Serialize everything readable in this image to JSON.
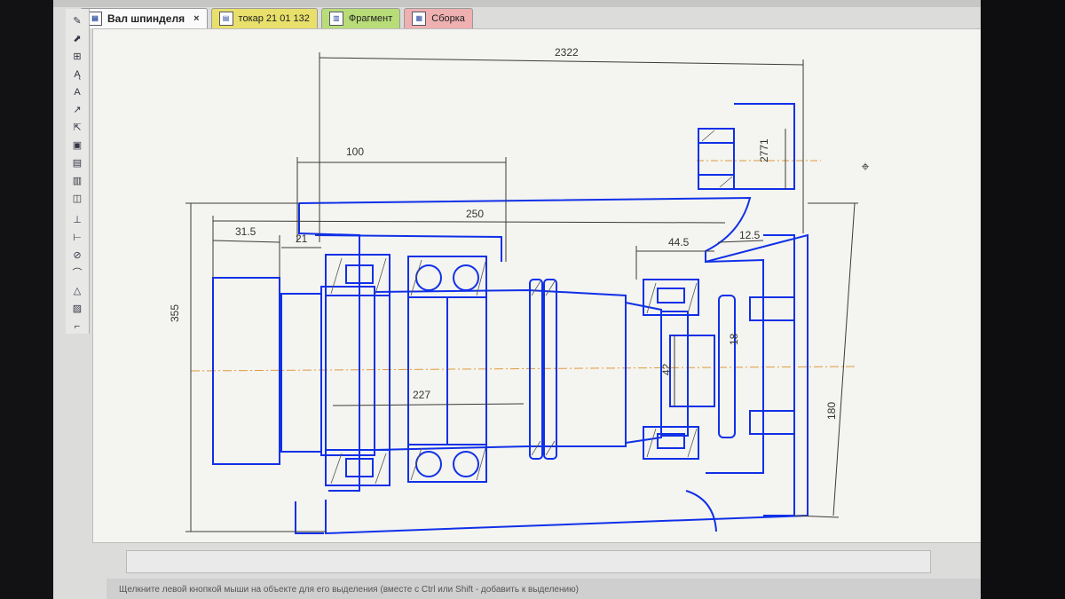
{
  "tabs": [
    {
      "label": "Вал шпинделя",
      "close": "×",
      "style": "active",
      "icon": "document-icon"
    },
    {
      "label": "токар 21 01 132",
      "style": "yellow",
      "icon": "document-icon"
    },
    {
      "label": "Фрагмент",
      "style": "green",
      "icon": "fragment-icon"
    },
    {
      "label": "Сборка",
      "style": "pink",
      "icon": "assembly-icon"
    }
  ],
  "toolbar": {
    "tools": [
      "geometry-tool",
      "edit-tool",
      "dimensions-tool",
      "notation-tool",
      "text-tool",
      "measure-tool",
      "select-tool",
      "parametrize-tool",
      "view-tool",
      "report-tool",
      "library-tool",
      "spec-tool",
      "axis-tool",
      "line-tool",
      "circle-tool",
      "arc-tool",
      "polygon-tool",
      "hatch-tool",
      "chamfer-tool"
    ]
  },
  "colors": {
    "geometry": "#1030e8",
    "dimension": "#3a3a3a",
    "axis": "#e09a3a",
    "canvas": "#f4f4f0"
  },
  "drawing": {
    "dimensions": {
      "d_top": "2322",
      "d_100": "100",
      "d_250": "250",
      "d_315": "31.5",
      "d_21": "21",
      "d_2771": "2771",
      "d_445": "44.5",
      "d_125": "12.5",
      "d_355": "355",
      "d_227": "227",
      "d_180": "180",
      "d_inner": "42",
      "d_small": "18"
    }
  },
  "status": {
    "text": "Щелкните левой кнопкой мыши на объекте для его выделения (вместе с Ctrl или Shift - добавить к выделению)"
  }
}
